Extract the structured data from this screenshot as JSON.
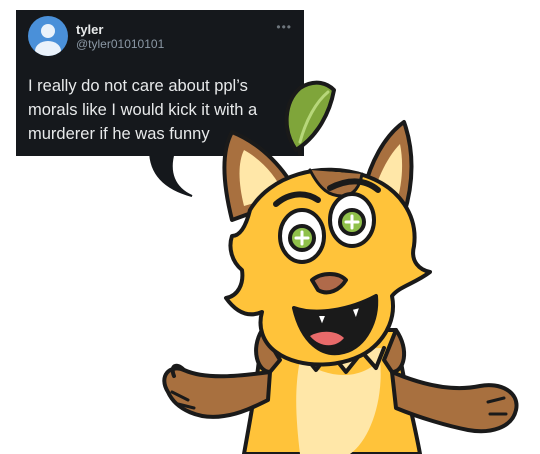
{
  "tweet": {
    "display_name": "tyler",
    "handle": "@tyler01010101",
    "more_icon": "ellipsis-icon",
    "text": "I really do not care about ppl’s morals like I would kick it with a murderer if he was funny"
  },
  "colors": {
    "card_bg": "#15181c",
    "text": "#e7e9ea",
    "handle": "#8b98a5",
    "avatar": "#4a90d9",
    "fox_yellow": "#ffc33a",
    "fox_brown": "#a8703f",
    "leaf": "#7fa53a"
  },
  "illustration": {
    "name": "cartoon-fox-shrugging-icon"
  }
}
